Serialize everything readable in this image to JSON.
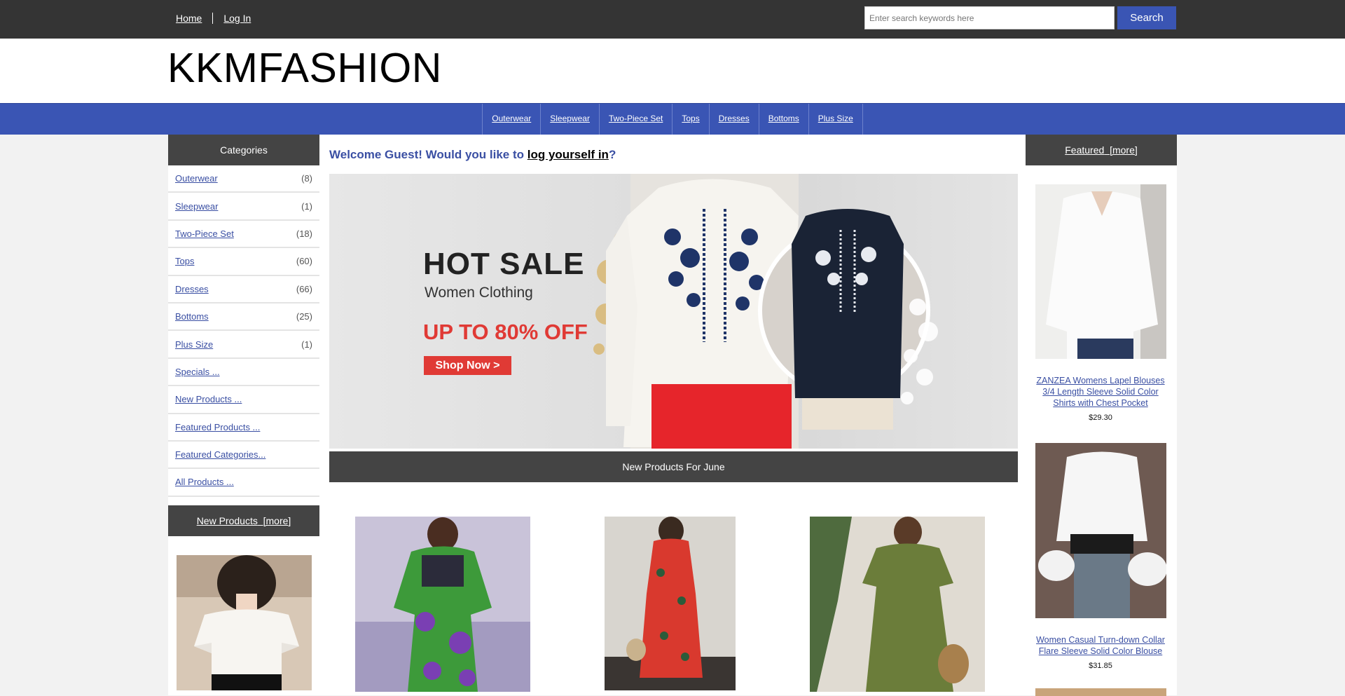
{
  "topbar": {
    "home": "Home",
    "login": "Log In",
    "search_placeholder": "Enter search keywords here",
    "search_button": "Search"
  },
  "logo": "KKMFASHION",
  "catnav": [
    "Outerwear",
    "Sleepwear",
    "Two-Piece Set",
    "Tops",
    "Dresses",
    "Bottoms",
    "Plus Size"
  ],
  "categories": {
    "heading": "Categories",
    "items": [
      {
        "label": "Outerwear",
        "count": "(8)"
      },
      {
        "label": "Sleepwear",
        "count": "(1)"
      },
      {
        "label": "Two-Piece Set",
        "count": "(18)"
      },
      {
        "label": "Tops",
        "count": "(60)"
      },
      {
        "label": "Dresses",
        "count": "(66)"
      },
      {
        "label": "Bottoms",
        "count": "(25)"
      },
      {
        "label": "Plus Size",
        "count": "(1)"
      }
    ],
    "links": [
      "Specials ...",
      "New Products ...",
      "Featured Products ...",
      "Featured Categories...",
      "All Products ..."
    ]
  },
  "new_products_box": {
    "heading": "New Products",
    "more": "[more]"
  },
  "welcome": {
    "prefix": "Welcome Guest! Would you like to ",
    "link": "log yourself in",
    "suffix": "?"
  },
  "banner": {
    "hot": "HOT SALE",
    "women": "Women Clothing",
    "off": "UP TO 80% OFF",
    "shop": "Shop Now >"
  },
  "new_products_heading": "New Products For June",
  "featured": {
    "heading": "Featured",
    "more": "[more]",
    "items": [
      {
        "name": "ZANZEA Womens Lapel Blouses 3/4 Length Sleeve Solid Color Shirts with Chest Pocket",
        "price": "$29.30"
      },
      {
        "name": "Women Casual Turn-down Collar Flare Sleeve Solid Color Blouse",
        "price": "$31.85"
      }
    ]
  },
  "colors": {
    "accent": "#3a55b4",
    "dark": "#444444",
    "sale_red": "#e03a35",
    "link": "#3a4fa3"
  }
}
